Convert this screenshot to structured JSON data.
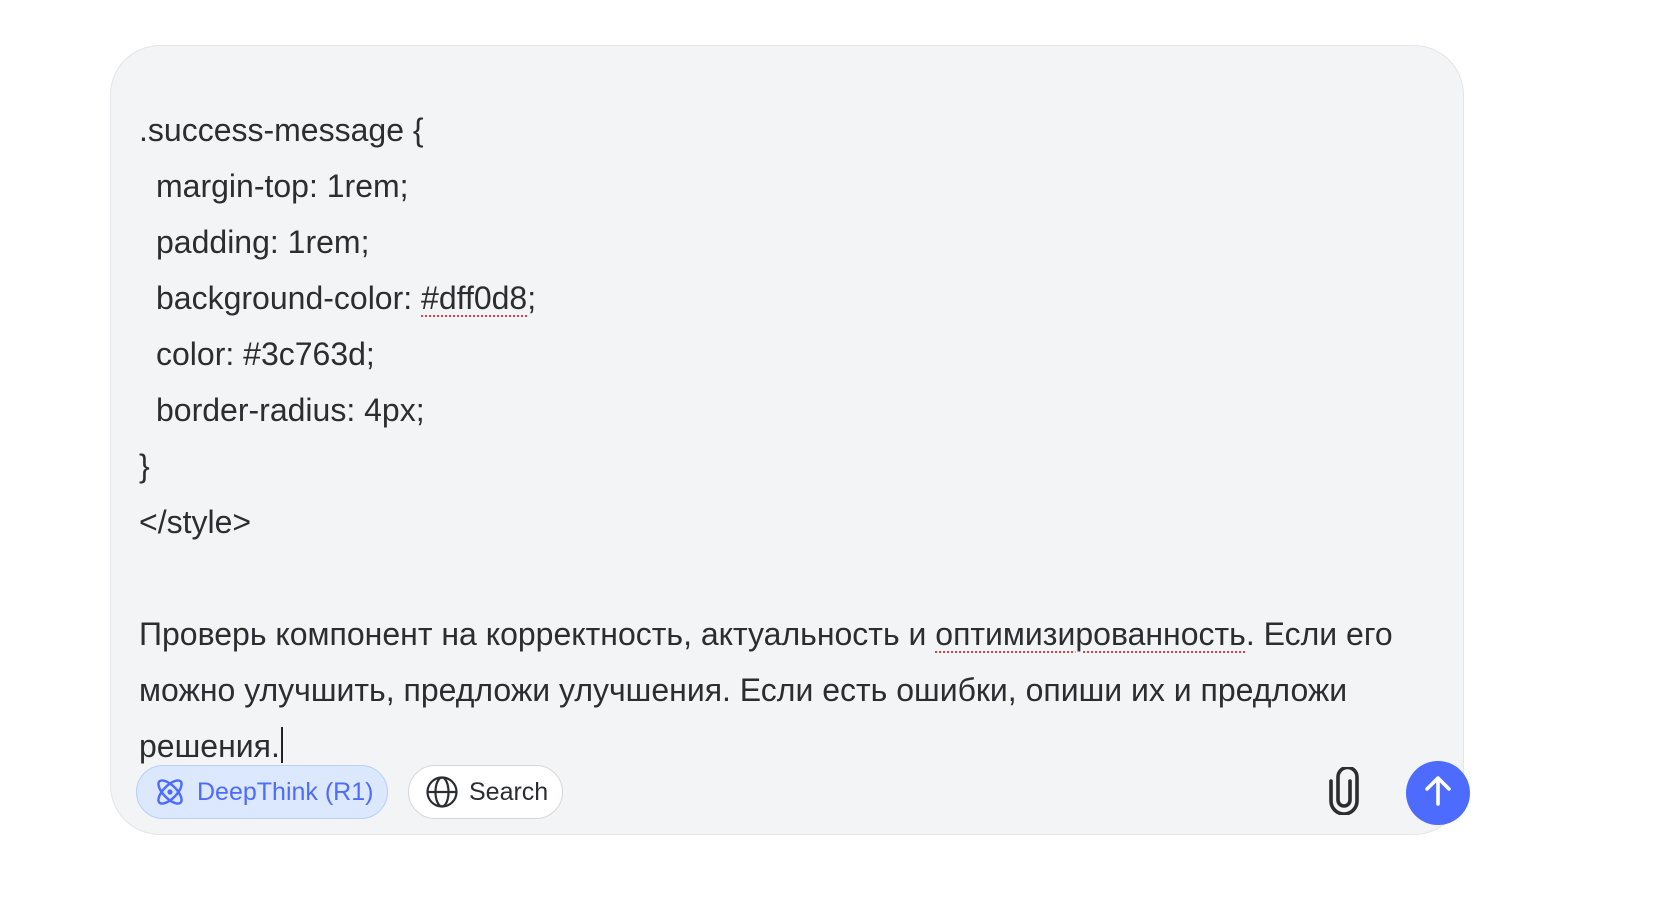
{
  "composer": {
    "code_lines": [
      ".success-message {",
      "margin-top: 1rem;",
      "padding: 1rem;",
      "background-color: ",
      "#dff0d8",
      ";",
      "color: #3c763d;",
      "border-radius: 4px;",
      "}",
      "</style>"
    ],
    "prompt_lines": {
      "l1_before": "Проверь компонент на корректность, актуальность и ",
      "l1_misspelled": "оптимизированность",
      "l1_after": ". Если его",
      "l2": "можно улучшить, предложи улучшения. Если есть ошибки, опиши их и предложи",
      "l3": "решения."
    }
  },
  "toolbar": {
    "deepthink_label": "DeepThink (R1)",
    "search_label": "Search",
    "deepthink_icon": "atom-icon",
    "search_icon": "globe-icon",
    "attach_icon": "paperclip-icon",
    "send_icon": "arrow-up-icon"
  },
  "colors": {
    "accent": "#4d6bfe",
    "composer_bg": "#f3f4f6",
    "deepthink_bg": "#dbe8fe",
    "text": "#2b2d31",
    "spellcheck": "#e0433f"
  }
}
